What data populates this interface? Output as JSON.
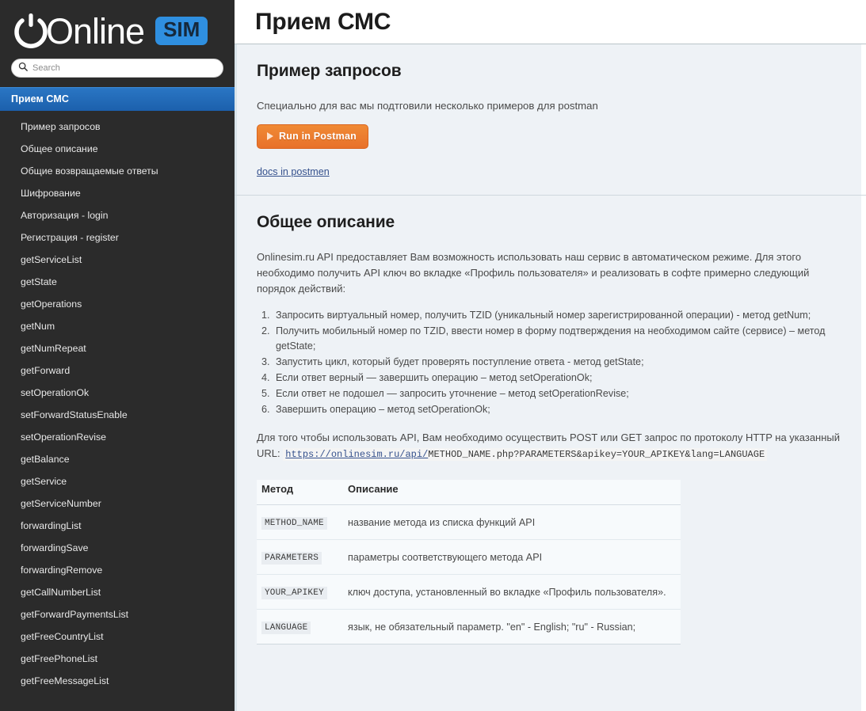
{
  "brand": {
    "name": "Online",
    "badge": "SIM",
    "badge_color": "#2f8fe0"
  },
  "search": {
    "placeholder": "Search",
    "value": "",
    "icon": "search-icon"
  },
  "sidebar": {
    "active_item": "Прием СМС",
    "items": [
      "Пример запросов",
      "Общее описание",
      "Общие возвращаемые ответы",
      "Шифрование",
      "Авторизация - login",
      "Регистрация - register",
      "getServiceList",
      "getState",
      "getOperations",
      "getNum",
      "getNumRepeat",
      "getForward",
      "setOperationOk",
      "setForwardStatusEnable",
      "setOperationRevise",
      "getBalance",
      "getService",
      "getServiceNumber",
      "forwardingList",
      "forwardingSave",
      "forwardingRemove",
      "getCallNumberList",
      "getForwardPaymentsList",
      "getFreeCountryList",
      "getFreePhoneList",
      "getFreeMessageList"
    ]
  },
  "header": {
    "title": "Прием СМС"
  },
  "examples": {
    "title": "Пример запросов",
    "lead": "Специально для вас мы подтговили несколько примеров для postman",
    "button_label": "Run in Postman",
    "button_color": "#e8712a",
    "link_label": "docs in postmen"
  },
  "overview": {
    "title": "Общее описание",
    "intro": "Onlinesim.ru API предоставляет Вам возможность использовать наш сервис в автоматическом режиме. Для этого необходимо получить API ключ во вкладке «Профиль пользователя» и реализовать в софте примерно следующий порядок действий:",
    "steps": [
      "Запросить виртуальный номер, получить TZID (уникальный номер зарегистрированной операции) - метод getNum;",
      "Получить мобильный номер по TZID, ввести номер в форму подтверждения на необходимом сайте (сервисе) – метод getState;",
      "Запустить цикл, который будет проверять поступление ответа - метод getState;",
      "Если ответ верный — завершить операцию – метод setOperationOk;",
      "Если ответ не подошел — запросить уточнение – метод setOperationRevise;",
      "Завершить операцию – метод setOperationOk;"
    ],
    "url_intro": "Для того чтобы использовать API, Вам необходимо осуществить POST или GET запрос по протоколу HTTP на указанный URL:",
    "url_base": "https://onlinesim.ru/api/",
    "url_rest": "METHOD_NAME.php?PARAMETERS&apikey=YOUR_APIKEY&lang=LANGUAGE",
    "table": {
      "headers": [
        "Метод",
        "Описание"
      ],
      "rows": [
        {
          "method": "METHOD_NAME",
          "description": "название метода из списка функций API"
        },
        {
          "method": "PARAMETERS",
          "description": "параметры соответствующего метода API"
        },
        {
          "method": "YOUR_APIKEY",
          "description": "ключ доступа, установленный во вкладке «Профиль пользователя»."
        },
        {
          "method": "LANGUAGE",
          "description": "язык, не обязательный параметр. \"en\" - English; \"ru\" - Russian;"
        }
      ]
    }
  }
}
